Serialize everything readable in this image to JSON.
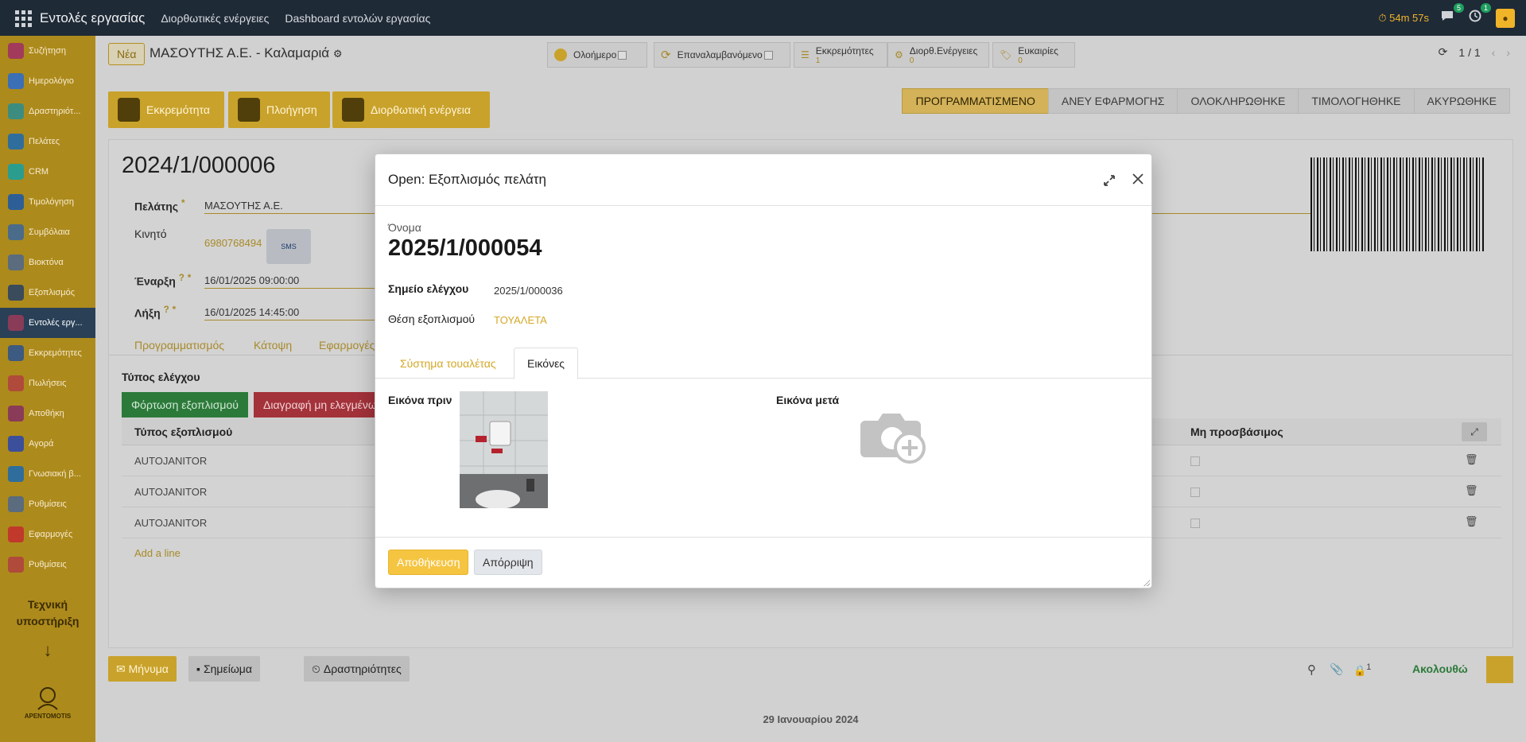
{
  "navbar": {
    "app_title": "Εντολές εργασίας",
    "links": [
      "Διορθωτικές ενέργειες",
      "Dashboard εντολών εργασίας"
    ],
    "timer": "⏱ 54m 57s",
    "messages_count": "5",
    "activities_count": "1"
  },
  "sidebar": {
    "items": [
      {
        "label": "Συζήτηση",
        "color": "#a23a5b"
      },
      {
        "label": "Ημερολόγιο",
        "color": "#3b6fb6"
      },
      {
        "label": "Δραστηριότ...",
        "color": "#3c8d7f"
      },
      {
        "label": "Πελάτες",
        "color": "#2f6e9c"
      },
      {
        "label": "CRM",
        "color": "#2a9d8f"
      },
      {
        "label": "Τιμολόγηση",
        "color": "#2d5f96"
      },
      {
        "label": "Συμβόλαια",
        "color": "#4a6b8a"
      },
      {
        "label": "Βιοκτόνα",
        "color": "#5a6c7d"
      },
      {
        "label": "Εξοπλισμός",
        "color": "#3a4b5c"
      },
      {
        "label": "Εντολές εργ...",
        "color": "#8a3b58"
      },
      {
        "label": "Εκκρεμότητες",
        "color": "#3d5a80"
      },
      {
        "label": "Πωλήσεις",
        "color": "#b04a3a"
      },
      {
        "label": "Αποθήκη",
        "color": "#8a3b58"
      },
      {
        "label": "Αγορά",
        "color": "#3b4f9a"
      },
      {
        "label": "Γνωσιακή β...",
        "color": "#2f6e9c"
      },
      {
        "label": "Ρυθμίσεις",
        "color": "#5a6c7d"
      },
      {
        "label": "Εφαρμογές",
        "color": "#c0392b"
      },
      {
        "label": "Ρυθμίσεις",
        "color": "#b04a3a"
      }
    ],
    "active_index": 9,
    "support_text_1": "Τεχνική",
    "support_text_2": "υποστήριξη",
    "arrow": "↓",
    "logo_text": "ΑΡΕΝΤΟΜΟΤΙS"
  },
  "control_panel": {
    "new_button": "Νέα",
    "breadcrumb": "ΜΑΣΟΥΤΗΣ Α.Ε. - Καλαμαριά",
    "smart_buttons": [
      {
        "label": "Ολοήμερο",
        "value": ""
      },
      {
        "label": "Επαναλαμβανόμενο",
        "value": ""
      },
      {
        "label": "Εκκρεμότητες",
        "value": "1"
      },
      {
        "label": "Διορθ.Ενέργειες",
        "value": "0"
      },
      {
        "label": "Ευκαιρίες",
        "value": "0"
      }
    ],
    "pager": "1 / 1"
  },
  "actions": {
    "pending": "Εκκρεμότητα",
    "navigation": "Πλοήγηση",
    "corrective": "Διορθωτική ενέργεια"
  },
  "statusbar": {
    "stages": [
      "ΠΡΟΓΡΑΜΜΑΤΙΣΜΕΝΟ",
      "ΑΝΕΥ ΕΦΑΡΜΟΓΗΣ",
      "ΟΛΟΚΛΗΡΩΘΗΚΕ",
      "ΤΙΜΟΛΟΓΗΘΗΚΕ",
      "ΑΚΥΡΩΘΗΚΕ"
    ],
    "current": 0
  },
  "form": {
    "record_name": "2024/1/000006",
    "customer_label": "Πελάτης",
    "customer_value": "ΜΑΣΟΥΤΗΣ Α.Ε.",
    "mobile_label": "Κινητό",
    "mobile_value": "6980768494",
    "sms_label": "SMS",
    "start_label": "Έναρξη",
    "start_value": "16/01/2025 09:00:00",
    "end_label": "Λήξη",
    "end_value": "16/01/2025 14:45:00",
    "tabs": [
      "Προγραμματισμός",
      "Κάτοψη",
      "Εφαρμογές"
    ],
    "check_type_label": "Τύπος ελέγχου",
    "load_equipment_button": "Φόρτωση εξοπλισμού",
    "delete_unchecked_button": "Διαγραφή μη ελεγμένων",
    "list_header_type": "Τύπος εξοπλισμού",
    "list_header_inaccessible": "Μη προσβάσιμος",
    "rows": [
      "AUTOJANITOR",
      "AUTOJANITOR",
      "AUTOJANITOR"
    ],
    "add_line": "Add a line"
  },
  "chatter": {
    "message_button": "✉ Μήνυμα",
    "note_button": "Σημείωμα",
    "activities_button": "Δραστηριότητες",
    "follow_label": "Ακολουθώ",
    "followers_count": "1",
    "date_separator": "29 Ιανουαρίου 2024"
  },
  "modal": {
    "title": "Open: Εξοπλισμός πελάτη",
    "name_label": "Όνομα",
    "name_value": "2025/1/000054",
    "checkpoint_label": "Σημείο ελέγχου",
    "checkpoint_value": "2025/1/000036",
    "position_label": "Θέση εξοπλισμού",
    "position_value": "ΤΟΥΑΛΕΤΑ",
    "tabs": [
      "Σύστημα τουαλέτας",
      "Εικόνες"
    ],
    "active_tab": 1,
    "image_before_label": "Εικόνα πριν",
    "image_after_label": "Εικόνα μετά",
    "save_button": "Αποθήκευση",
    "discard_button": "Απόρριψη"
  }
}
